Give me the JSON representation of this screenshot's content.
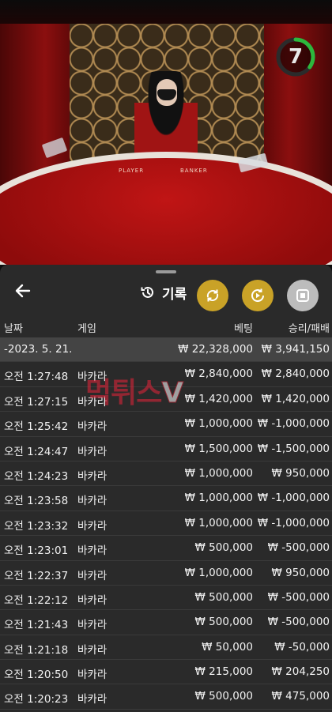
{
  "timer": {
    "value": "7",
    "progress": 0.35,
    "color": "#2db83d"
  },
  "table_labels": {
    "player": "PLAYER",
    "banker": "BANKER"
  },
  "panel": {
    "title": "기록",
    "icons": [
      "history-icon",
      "back-arrow-icon",
      "refresh-icon",
      "replay-icon",
      "stop-icon"
    ],
    "accent_gold": "#c9a227",
    "columns": {
      "date": "날짜",
      "game": "게임",
      "bet": "베팅",
      "result": "승리/패배"
    },
    "summary": {
      "date": "-2023. 5. 21.",
      "bet": "₩ 22,328,000",
      "result": "₩ 3,941,150"
    },
    "rows": [
      {
        "time": "오전 1:27:48",
        "game": "바카라",
        "bet": "₩ 2,840,000",
        "result": "₩ 2,840,000"
      },
      {
        "time": "오전 1:27:15",
        "game": "바카라",
        "bet": "₩ 1,420,000",
        "result": "₩ 1,420,000"
      },
      {
        "time": "오전 1:25:42",
        "game": "바카라",
        "bet": "₩ 1,000,000",
        "result": "₩ -1,000,000"
      },
      {
        "time": "오전 1:24:47",
        "game": "바카라",
        "bet": "₩ 1,500,000",
        "result": "₩ -1,500,000"
      },
      {
        "time": "오전 1:24:23",
        "game": "바카라",
        "bet": "₩ 1,000,000",
        "result": "₩ 950,000"
      },
      {
        "time": "오전 1:23:58",
        "game": "바카라",
        "bet": "₩ 1,000,000",
        "result": "₩ -1,000,000"
      },
      {
        "time": "오전 1:23:32",
        "game": "바카라",
        "bet": "₩ 1,000,000",
        "result": "₩ -1,000,000"
      },
      {
        "time": "오전 1:23:01",
        "game": "바카라",
        "bet": "₩ 500,000",
        "result": "₩ -500,000"
      },
      {
        "time": "오전 1:22:37",
        "game": "바카라",
        "bet": "₩ 1,000,000",
        "result": "₩ 950,000"
      },
      {
        "time": "오전 1:22:12",
        "game": "바카라",
        "bet": "₩ 500,000",
        "result": "₩ -500,000"
      },
      {
        "time": "오전 1:21:43",
        "game": "바카라",
        "bet": "₩ 500,000",
        "result": "₩ -500,000"
      },
      {
        "time": "오전 1:21:18",
        "game": "바카라",
        "bet": "₩ 50,000",
        "result": "₩ -50,000"
      },
      {
        "time": "오전 1:20:50",
        "game": "바카라",
        "bet": "₩ 215,000",
        "result": "₩ 204,250"
      },
      {
        "time": "오전 1:20:23",
        "game": "바카라",
        "bet": "₩ 500,000",
        "result": "₩ 475,000"
      }
    ]
  },
  "watermark": {
    "text": "먹튀스",
    "v": "V"
  }
}
